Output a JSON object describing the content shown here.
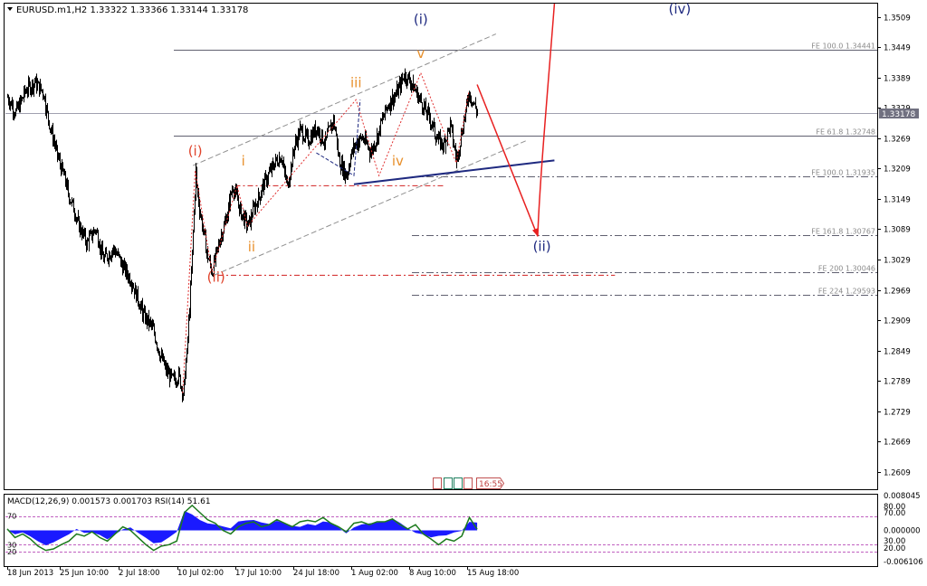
{
  "window": {
    "title": "EURUSD.m1,H2  1.33322 1.33366 1.33144 1.33178",
    "timer": "16:55",
    "colors": {
      "background": "#ffffff",
      "bull": "#000000",
      "bear": "#000000",
      "grid": "#c0c0c0"
    }
  },
  "chart_data": [
    {
      "type": "candlestick",
      "symbol": "EURUSD.m1",
      "timeframe": "H2",
      "ohlc_current": {
        "open": 1.33322,
        "high": 1.33366,
        "low": 1.33144,
        "close": 1.33178
      },
      "price_axis_ticks": [
        1.3509,
        1.3449,
        1.3389,
        1.3329,
        1.3269,
        1.3209,
        1.3149,
        1.3089,
        1.3029,
        1.2969,
        1.2909,
        1.2849,
        1.2789,
        1.2729,
        1.2669,
        1.2609
      ],
      "ylim": [
        1.2575,
        1.3535
      ],
      "current_price_label": "1.33178",
      "time_axis_labels": [
        "18 Jun 2013",
        "25 Jun 10:00",
        "2 Jul 18:00",
        "10 Jul 02:00",
        "17 Jul 10:00",
        "24 Jul 18:00",
        "1 Aug 02:00",
        "8 Aug 10:00",
        "15 Aug 18:00"
      ],
      "price_path_points": [
        {
          "t": 0,
          "p": 1.335
        },
        {
          "t": 0.4,
          "p": 1.332
        },
        {
          "t": 0.9,
          "p": 1.3365
        },
        {
          "t": 1.3,
          "p": 1.338
        },
        {
          "t": 1.7,
          "p": 1.336
        },
        {
          "t": 2.1,
          "p": 1.328
        },
        {
          "t": 2.5,
          "p": 1.322
        },
        {
          "t": 3.0,
          "p": 1.315
        },
        {
          "t": 3.4,
          "p": 1.31
        },
        {
          "t": 3.8,
          "p": 1.306
        },
        {
          "t": 4.2,
          "p": 1.309
        },
        {
          "t": 4.6,
          "p": 1.303
        },
        {
          "t": 5.1,
          "p": 1.305
        },
        {
          "t": 5.6,
          "p": 1.301
        },
        {
          "t": 6.0,
          "p": 1.298
        },
        {
          "t": 6.5,
          "p": 1.292
        },
        {
          "t": 7.0,
          "p": 1.289
        },
        {
          "t": 7.3,
          "p": 1.284
        },
        {
          "t": 7.6,
          "p": 1.281
        },
        {
          "t": 7.9,
          "p": 1.279
        },
        {
          "t": 8.2,
          "p": 1.28
        },
        {
          "t": 8.4,
          "p": 1.2765
        },
        {
          "t": 8.6,
          "p": 1.284
        },
        {
          "t": 8.8,
          "p": 1.3
        },
        {
          "t": 9.0,
          "p": 1.3205
        },
        {
          "t": 9.2,
          "p": 1.313
        },
        {
          "t": 9.5,
          "p": 1.305
        },
        {
          "t": 9.8,
          "p": 1.3005
        },
        {
          "t": 10.1,
          "p": 1.306
        },
        {
          "t": 10.4,
          "p": 1.31
        },
        {
          "t": 10.8,
          "p": 1.3175
        },
        {
          "t": 11.1,
          "p": 1.313
        },
        {
          "t": 11.5,
          "p": 1.3095
        },
        {
          "t": 11.9,
          "p": 1.314
        },
        {
          "t": 12.3,
          "p": 1.318
        },
        {
          "t": 12.7,
          "p": 1.3215
        },
        {
          "t": 13.1,
          "p": 1.3235
        },
        {
          "t": 13.4,
          "p": 1.3175
        },
        {
          "t": 13.7,
          "p": 1.3245
        },
        {
          "t": 14.0,
          "p": 1.3285
        },
        {
          "t": 14.4,
          "p": 1.3265
        },
        {
          "t": 14.8,
          "p": 1.329
        },
        {
          "t": 15.2,
          "p": 1.326
        },
        {
          "t": 15.6,
          "p": 1.3305
        },
        {
          "t": 15.9,
          "p": 1.3225
        },
        {
          "t": 16.2,
          "p": 1.3195
        },
        {
          "t": 16.6,
          "p": 1.3255
        },
        {
          "t": 17.0,
          "p": 1.327
        },
        {
          "t": 17.4,
          "p": 1.324
        },
        {
          "t": 17.8,
          "p": 1.3285
        },
        {
          "t": 18.2,
          "p": 1.3335
        },
        {
          "t": 18.6,
          "p": 1.3355
        },
        {
          "t": 19.0,
          "p": 1.3395
        },
        {
          "t": 19.4,
          "p": 1.3375
        },
        {
          "t": 19.8,
          "p": 1.334
        },
        {
          "t": 20.2,
          "p": 1.331
        },
        {
          "t": 20.6,
          "p": 1.3265
        },
        {
          "t": 20.9,
          "p": 1.3255
        },
        {
          "t": 21.2,
          "p": 1.3295
        },
        {
          "t": 21.5,
          "p": 1.322
        },
        {
          "t": 21.8,
          "p": 1.3295
        },
        {
          "t": 22.1,
          "p": 1.336
        },
        {
          "t": 22.5,
          "p": 1.3318
        }
      ],
      "horizontal_levels": [
        {
          "label": "FE 100.0 1.34441",
          "price": 1.34441,
          "style": "solid"
        },
        {
          "label": "FE 61.8 1.32748",
          "price": 1.32748,
          "style": "solid"
        },
        {
          "label": "FE 100.0 1.31935",
          "price": 1.31935,
          "style": "dashdot"
        },
        {
          "label": "FE 161.8 1.30767",
          "price": 1.30767,
          "style": "dashdot"
        },
        {
          "label": "FE 200 1.30046",
          "price": 1.30046,
          "style": "dashdot"
        },
        {
          "label": "FE 224 1.29593",
          "price": 1.29593,
          "style": "dashdot"
        }
      ],
      "wave_labels": [
        {
          "text": "(i)",
          "color": "#e0442c",
          "t": 9.0,
          "p": 1.3235
        },
        {
          "text": "(ii)",
          "color": "#e0442c",
          "t": 10.0,
          "p": 1.2985
        },
        {
          "text": "i",
          "color": "#e8902c",
          "t": 11.3,
          "p": 1.3215
        },
        {
          "text": "ii",
          "color": "#e8902c",
          "t": 11.7,
          "p": 1.3045
        },
        {
          "text": "iii",
          "color": "#e8902c",
          "t": 16.7,
          "p": 1.337
        },
        {
          "text": "iv",
          "color": "#e8902c",
          "t": 18.7,
          "p": 1.3215
        },
        {
          "text": "v",
          "color": "#e8902c",
          "t": 19.8,
          "p": 1.3428
        },
        {
          "text": "(i)",
          "color": "#1f2a80",
          "t": 19.8,
          "p": 1.3495
        },
        {
          "text": "(ii)",
          "color": "#1f2a80",
          "t": 25.6,
          "p": 1.3046
        },
        {
          "text": "(iv)",
          "color": "#1f2a80",
          "t": 32.2,
          "p": 1.3515
        }
      ],
      "forecast_path": [
        {
          "t": 22.5,
          "p": 1.3375
        },
        {
          "t": 25.4,
          "p": 1.3075
        },
        {
          "t": 26.2,
          "p": 1.3555
        }
      ]
    },
    {
      "type": "line",
      "title": "MACD(12,26,9) 0.001573 0.001703 RSI(14) 51.61",
      "right_ticks": [
        "0.008045",
        "80.00",
        "70.00",
        "0.000000",
        "30.00",
        "20.00",
        "-0.006106"
      ],
      "left_ticks": [
        "70",
        "30",
        "20"
      ],
      "rsi_levels": [
        70,
        30,
        20
      ],
      "series": [
        {
          "name": "RSI(14)",
          "color": "#1c7a1c",
          "values": [
            52,
            40,
            45,
            38,
            28,
            22,
            24,
            30,
            35,
            45,
            42,
            48,
            40,
            35,
            45,
            55,
            50,
            40,
            30,
            22,
            28,
            30,
            35,
            75,
            85,
            75,
            65,
            60,
            50,
            45,
            55,
            60,
            62,
            55,
            58,
            65,
            60,
            55,
            62,
            64,
            62,
            68,
            60,
            55,
            48,
            60,
            62,
            58,
            62,
            62,
            66,
            58,
            52,
            58,
            45,
            38,
            30,
            38,
            35,
            42,
            68,
            51.61
          ]
        },
        {
          "name": "MACD(12,26,9)",
          "color": "#0000ff",
          "values": [
            0.1,
            -0.8,
            -0.4,
            -1.2,
            -2.2,
            -3.0,
            -2.4,
            -1.6,
            -0.8,
            0.3,
            -0.5,
            -0.4,
            -0.9,
            -1.8,
            -0.8,
            0.2,
            0.6,
            -0.5,
            -1.5,
            -2.6,
            -2.4,
            -1.4,
            -0.3,
            3.9,
            3.2,
            2.1,
            1.4,
            1.2,
            0.8,
            0.4,
            1.8,
            2.0,
            2.1,
            1.6,
            1.3,
            1.9,
            1.5,
            0.9,
            0.7,
            1.3,
            1.0,
            1.8,
            1.6,
            0.6,
            -0.6,
            0.6,
            1.2,
            1.4,
            1.6,
            1.8,
            2.4,
            1.5,
            0.4,
            -0.5,
            -0.8,
            -1.4,
            -1.1,
            -1.0,
            -0.4,
            -0.1,
            1.7,
            1.573
          ]
        }
      ]
    }
  ]
}
